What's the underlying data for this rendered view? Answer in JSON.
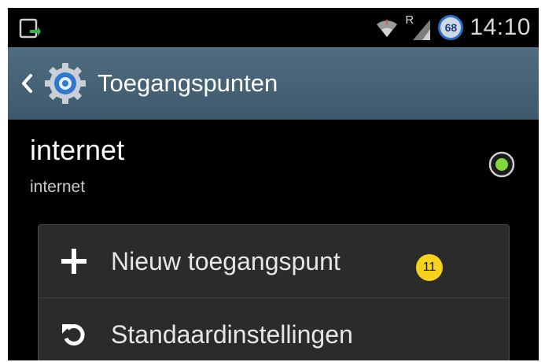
{
  "status_bar": {
    "time": "14:10",
    "battery_level": "68",
    "roaming_indicator": "R",
    "icons": [
      "download-notification-icon",
      "wifi-icon",
      "signal-icon",
      "battery-icon"
    ]
  },
  "action_bar": {
    "title": "Toegangspunten",
    "icons": [
      "back-icon",
      "settings-icon"
    ]
  },
  "apn": {
    "name": "internet",
    "apn_value": "internet",
    "selected": true
  },
  "menu": {
    "items": [
      {
        "label": "Nieuw toegangspunt",
        "icon": "plus-icon"
      },
      {
        "label": "Standaardinstellingen",
        "icon": "reset-icon"
      }
    ]
  },
  "annotation": {
    "step_number": "11"
  },
  "colors": {
    "accent_radio": "#7fd83a",
    "action_bar": "#4a6579",
    "step_badge": "#f6d21b"
  }
}
